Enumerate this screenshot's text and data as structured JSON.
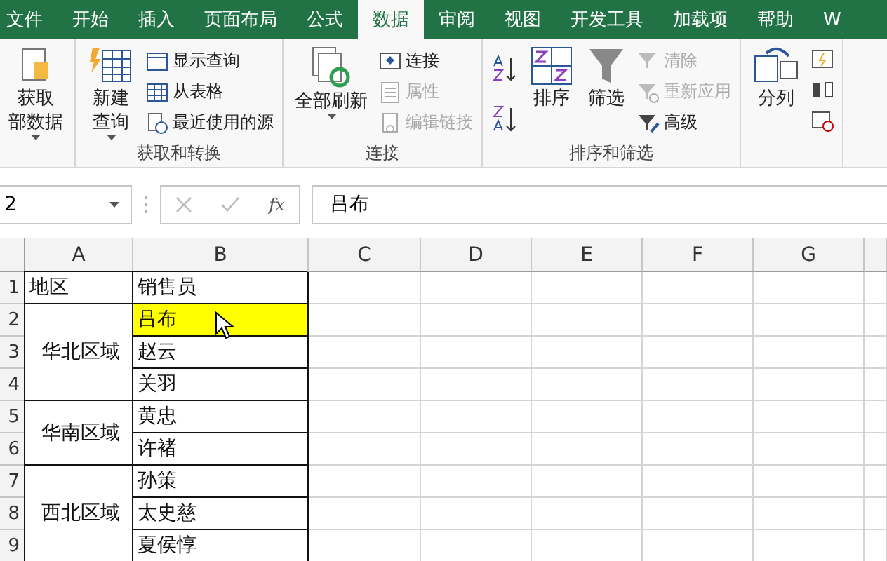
{
  "tabs": [
    {
      "label": "文件",
      "selected": false
    },
    {
      "label": "开始",
      "selected": false
    },
    {
      "label": "插入",
      "selected": false
    },
    {
      "label": "页面布局",
      "selected": false
    },
    {
      "label": "公式",
      "selected": false
    },
    {
      "label": "数据",
      "selected": true
    },
    {
      "label": "审阅",
      "selected": false
    },
    {
      "label": "视图",
      "selected": false
    },
    {
      "label": "开发工具",
      "selected": false
    },
    {
      "label": "加载项",
      "selected": false
    },
    {
      "label": "帮助",
      "selected": false
    },
    {
      "label": "W",
      "selected": false
    }
  ],
  "ribbon": {
    "groups": [
      {
        "items": [
          {
            "kind": "large",
            "lines": [
              "获取",
              "部数据"
            ],
            "dropdown": true
          }
        ]
      },
      {
        "label": "获取和转换",
        "items": [
          {
            "kind": "large",
            "lines": [
              "新建",
              "查询"
            ],
            "dropdown": true
          },
          {
            "kind": "stack",
            "items": [
              {
                "label": "显示查询",
                "disabled": false
              },
              {
                "label": "从表格",
                "disabled": false
              },
              {
                "label": "最近使用的源",
                "disabled": false
              }
            ]
          }
        ]
      },
      {
        "label": "连接",
        "items": [
          {
            "kind": "large",
            "lines": [
              "全部刷新"
            ],
            "dropdown": true
          },
          {
            "kind": "stack",
            "items": [
              {
                "label": "连接",
                "disabled": false
              },
              {
                "label": "属性",
                "disabled": true
              },
              {
                "label": "编辑链接",
                "disabled": true
              }
            ]
          }
        ]
      },
      {
        "label": "排序和筛选",
        "items": [
          {
            "kind": "sortpair"
          },
          {
            "kind": "large",
            "lines": [
              "排序"
            ],
            "dropdown": false
          },
          {
            "kind": "large",
            "lines": [
              "筛选"
            ],
            "dropdown": false
          },
          {
            "kind": "stack",
            "items": [
              {
                "label": "清除",
                "disabled": true
              },
              {
                "label": "重新应用",
                "disabled": true
              },
              {
                "label": "高级",
                "disabled": false
              }
            ]
          }
        ]
      },
      {
        "items": [
          {
            "kind": "large",
            "lines": [
              "分列"
            ],
            "dropdown": false
          },
          {
            "kind": "iconstack"
          }
        ]
      }
    ]
  },
  "formula_bar": {
    "name_box": "2",
    "function_label": "fx",
    "value": "吕布"
  },
  "sheet": {
    "columns": [
      "A",
      "B",
      "C",
      "D",
      "E",
      "F",
      "G"
    ],
    "row_numbers": [
      "1",
      "2",
      "3",
      "4",
      "5",
      "6",
      "7",
      "8",
      "9"
    ],
    "header": {
      "region": "地区",
      "salesperson": "销售员"
    },
    "groups": [
      {
        "region": "华北区域",
        "salespeople": [
          {
            "name": "吕布",
            "highlighted": true
          },
          {
            "name": "赵云",
            "highlighted": false
          },
          {
            "name": "关羽",
            "highlighted": false
          }
        ]
      },
      {
        "region": "华南区域",
        "salespeople": [
          {
            "name": "黄忠",
            "highlighted": false
          },
          {
            "name": "许褚",
            "highlighted": false
          }
        ]
      },
      {
        "region": "西北区域",
        "salespeople": [
          {
            "name": "孙策",
            "highlighted": false
          },
          {
            "name": "太史慈",
            "highlighted": false
          },
          {
            "name": "夏侯惇",
            "highlighted": false
          }
        ]
      }
    ]
  }
}
